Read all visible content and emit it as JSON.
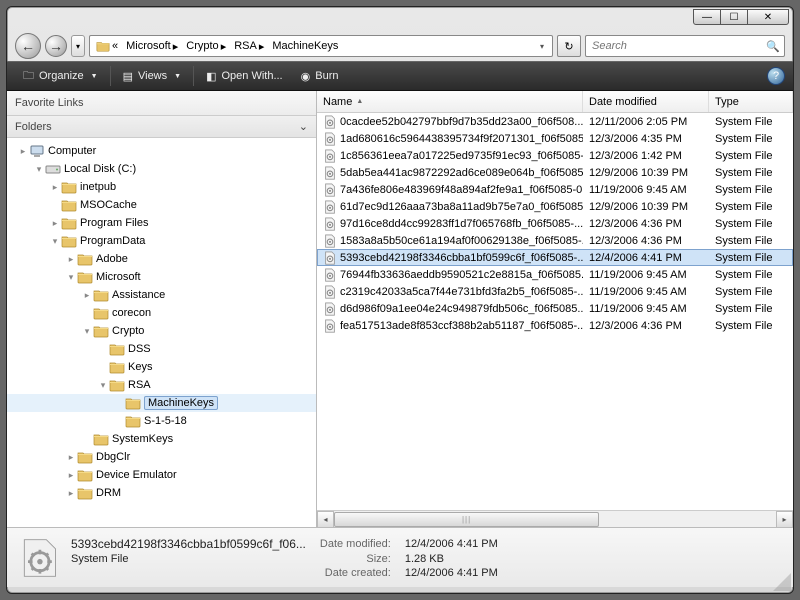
{
  "window_controls": {
    "min": "—",
    "max": "☐",
    "close": "✕"
  },
  "breadcrumbs": [
    "Microsoft",
    "Crypto",
    "RSA",
    "MachineKeys"
  ],
  "search": {
    "placeholder": "Search"
  },
  "toolbar": {
    "organize": "Organize",
    "views": "Views",
    "openwith": "Open With...",
    "burn": "Burn"
  },
  "panes": {
    "favorites": "Favorite Links",
    "folders": "Folders"
  },
  "tree": [
    {
      "d": 0,
      "exp": "▸",
      "icon": "computer",
      "label": "Computer"
    },
    {
      "d": 1,
      "exp": "▾",
      "icon": "drive",
      "label": "Local Disk (C:)"
    },
    {
      "d": 2,
      "exp": "▸",
      "icon": "folder",
      "label": "inetpub"
    },
    {
      "d": 2,
      "exp": "",
      "icon": "folder",
      "label": "MSOCache"
    },
    {
      "d": 2,
      "exp": "▸",
      "icon": "folder",
      "label": "Program Files"
    },
    {
      "d": 2,
      "exp": "▾",
      "icon": "folder",
      "label": "ProgramData"
    },
    {
      "d": 3,
      "exp": "▸",
      "icon": "folder",
      "label": "Adobe"
    },
    {
      "d": 3,
      "exp": "▾",
      "icon": "folder",
      "label": "Microsoft"
    },
    {
      "d": 4,
      "exp": "▸",
      "icon": "folder",
      "label": "Assistance"
    },
    {
      "d": 4,
      "exp": "",
      "icon": "folder",
      "label": "corecon"
    },
    {
      "d": 4,
      "exp": "▾",
      "icon": "folder",
      "label": "Crypto"
    },
    {
      "d": 5,
      "exp": "",
      "icon": "folder",
      "label": "DSS"
    },
    {
      "d": 5,
      "exp": "",
      "icon": "folder",
      "label": "Keys"
    },
    {
      "d": 5,
      "exp": "▾",
      "icon": "folder",
      "label": "RSA"
    },
    {
      "d": 6,
      "exp": "",
      "icon": "folder",
      "label": "MachineKeys",
      "sel": true
    },
    {
      "d": 6,
      "exp": "",
      "icon": "folder",
      "label": "S-1-5-18"
    },
    {
      "d": 4,
      "exp": "",
      "icon": "folder",
      "label": "SystemKeys"
    },
    {
      "d": 3,
      "exp": "▸",
      "icon": "folder",
      "label": "DbgClr"
    },
    {
      "d": 3,
      "exp": "▸",
      "icon": "folder",
      "label": "Device Emulator"
    },
    {
      "d": 3,
      "exp": "▸",
      "icon": "folder",
      "label": "DRM"
    }
  ],
  "columns": {
    "name": "Name",
    "date": "Date modified",
    "type": "Type"
  },
  "files": [
    {
      "name": "0cacdee52b042797bbf9d7b35dd23a00_f06f508...",
      "date": "12/11/2006 2:05 PM",
      "type": "System File"
    },
    {
      "name": "1ad680616c5964438395734f9f2071301_f06f5085-...",
      "date": "12/3/2006 4:35 PM",
      "type": "System File"
    },
    {
      "name": "1c856361eea7a017225ed9735f91ec93_f06f5085-...",
      "date": "12/3/2006 1:42 PM",
      "type": "System File"
    },
    {
      "name": "5dab5ea441ac9872292ad6ce089e064b_f06f5085...",
      "date": "12/9/2006 10:39 PM",
      "type": "System File"
    },
    {
      "name": "7a436fe806e483969f48a894af2fe9a1_f06f5085-0...",
      "date": "11/19/2006 9:45 AM",
      "type": "System File"
    },
    {
      "name": "61d7ec9d126aaa73ba8a11ad9b75e7a0_f06f5085...",
      "date": "12/9/2006 10:39 PM",
      "type": "System File"
    },
    {
      "name": "97d16ce8dd4cc99283ff1d7f065768fb_f06f5085-...",
      "date": "12/3/2006 4:36 PM",
      "type": "System File"
    },
    {
      "name": "1583a8a5b50ce61a194af0f00629138e_f06f5085-...",
      "date": "12/3/2006 4:36 PM",
      "type": "System File"
    },
    {
      "name": "5393cebd42198f3346cbba1bf0599c6f_f06f5085-...",
      "date": "12/4/2006 4:41 PM",
      "type": "System File",
      "sel": true
    },
    {
      "name": "76944fb33636aeddb9590521c2e8815a_f06f5085...",
      "date": "11/19/2006 9:45 AM",
      "type": "System File"
    },
    {
      "name": "c2319c42033a5ca7f44e731bfd3fa2b5_f06f5085-...",
      "date": "11/19/2006 9:45 AM",
      "type": "System File"
    },
    {
      "name": "d6d986f09a1ee04e24c949879fdb506c_f06f5085...",
      "date": "11/19/2006 9:45 AM",
      "type": "System File"
    },
    {
      "name": "fea517513ade8f853ccf388b2ab51187_f06f5085-...",
      "date": "12/3/2006 4:36 PM",
      "type": "System File"
    }
  ],
  "details": {
    "filename": "5393cebd42198f3346cbba1bf0599c6f_f06...",
    "filetype": "System File",
    "modified_label": "Date modified:",
    "modified": "12/4/2006 4:41 PM",
    "size_label": "Size:",
    "size": "1.28 KB",
    "created_label": "Date created:",
    "created": "12/4/2006 4:41 PM"
  }
}
